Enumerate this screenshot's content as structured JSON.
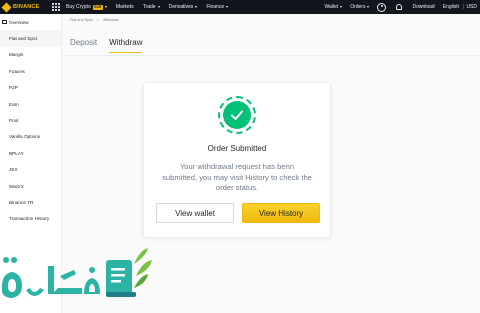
{
  "nav": {
    "logo": "BINANCE",
    "items": [
      {
        "label": "Buy Crypto",
        "badge": "EUR",
        "caret": true
      },
      {
        "label": "Markets",
        "caret": false
      },
      {
        "label": "Trade",
        "caret": true
      },
      {
        "label": "Derivatives",
        "caret": true
      },
      {
        "label": "Finance",
        "caret": true
      }
    ],
    "right": {
      "wallet": "Wallet",
      "orders": "Orders",
      "download": "Download",
      "language": "English",
      "currency": "USD"
    }
  },
  "sidebar": {
    "items": [
      {
        "label": "Overview"
      },
      {
        "label": "Fiat and Spot"
      },
      {
        "label": "Margin"
      },
      {
        "label": "Futures"
      },
      {
        "label": "P2P"
      },
      {
        "label": "Earn"
      },
      {
        "label": "Pool"
      },
      {
        "label": "Vanilla Options"
      },
      {
        "label": "BPLAY"
      },
      {
        "label": "JEX"
      },
      {
        "label": "WazirX"
      },
      {
        "label": "Binance TR"
      },
      {
        "label": "Transaction History"
      }
    ]
  },
  "breadcrumb": [
    "Fiat and Spot",
    ">",
    "Withdraw"
  ],
  "tabs": [
    "Deposit",
    "Withdraw"
  ],
  "dialog": {
    "title": "Order Submitted",
    "message": "Your withdrawal request has benn submitted, you  may visit History to check the order status.",
    "btn_wallet": "View wallet",
    "btn_history": "View History"
  },
  "watermark": {
    "text": "فكرة"
  },
  "colors": {
    "accent": "#f0b90b",
    "success": "#02c076",
    "nav_bg": "#12161c",
    "watermark": "#2bb3a3"
  }
}
